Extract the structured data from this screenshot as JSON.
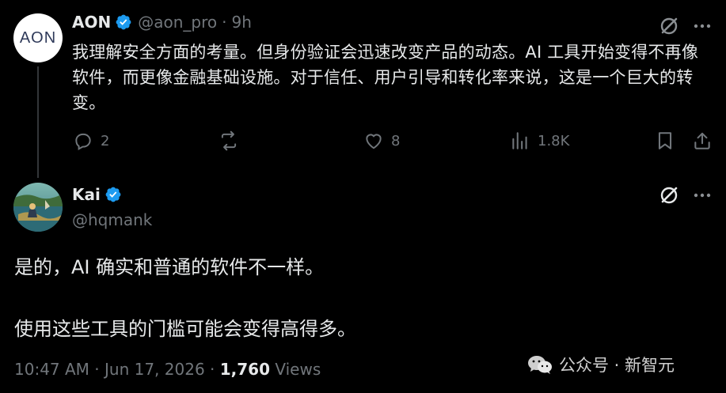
{
  "parent_tweet": {
    "avatar_text": "AON",
    "display_name": "AON",
    "handle": "@aon_pro",
    "separator": "·",
    "time": "9h",
    "text": "我理解安全方面的考量。但身份验证会迅速改变产品的动态。AI 工具开始变得不再像软件，而更像金融基础设施。对于信任、用户引导和转化率来说，这是一个巨大的转变。",
    "actions": {
      "reply_count": "2",
      "retweet_count": "",
      "like_count": "8",
      "views_count": "1.8K"
    },
    "icons": {
      "verified": "verified-badge-icon",
      "grok": "grok-icon",
      "more": "more-icon",
      "reply": "reply-icon",
      "retweet": "retweet-icon",
      "like": "like-icon",
      "views": "views-icon",
      "bookmark": "bookmark-icon",
      "share": "share-icon"
    }
  },
  "reply_tweet": {
    "display_name": "Kai",
    "handle": "@hqmank",
    "text_line1": "是的，AI 确实和普通的软件不一样。",
    "text_line2": "使用这些工具的门槛可能会变得高得多。",
    "timestamp": "10:47 AM · Jun 17, 2026 · ",
    "views_number": "1,760",
    "views_label": " Views"
  },
  "watermark": {
    "text": "公众号 · 新智元"
  },
  "colors": {
    "background": "#000000",
    "text_primary": "#e7e9ea",
    "text_secondary": "#71767b",
    "verified_blue": "#1d9bf0",
    "divider": "#333639"
  }
}
